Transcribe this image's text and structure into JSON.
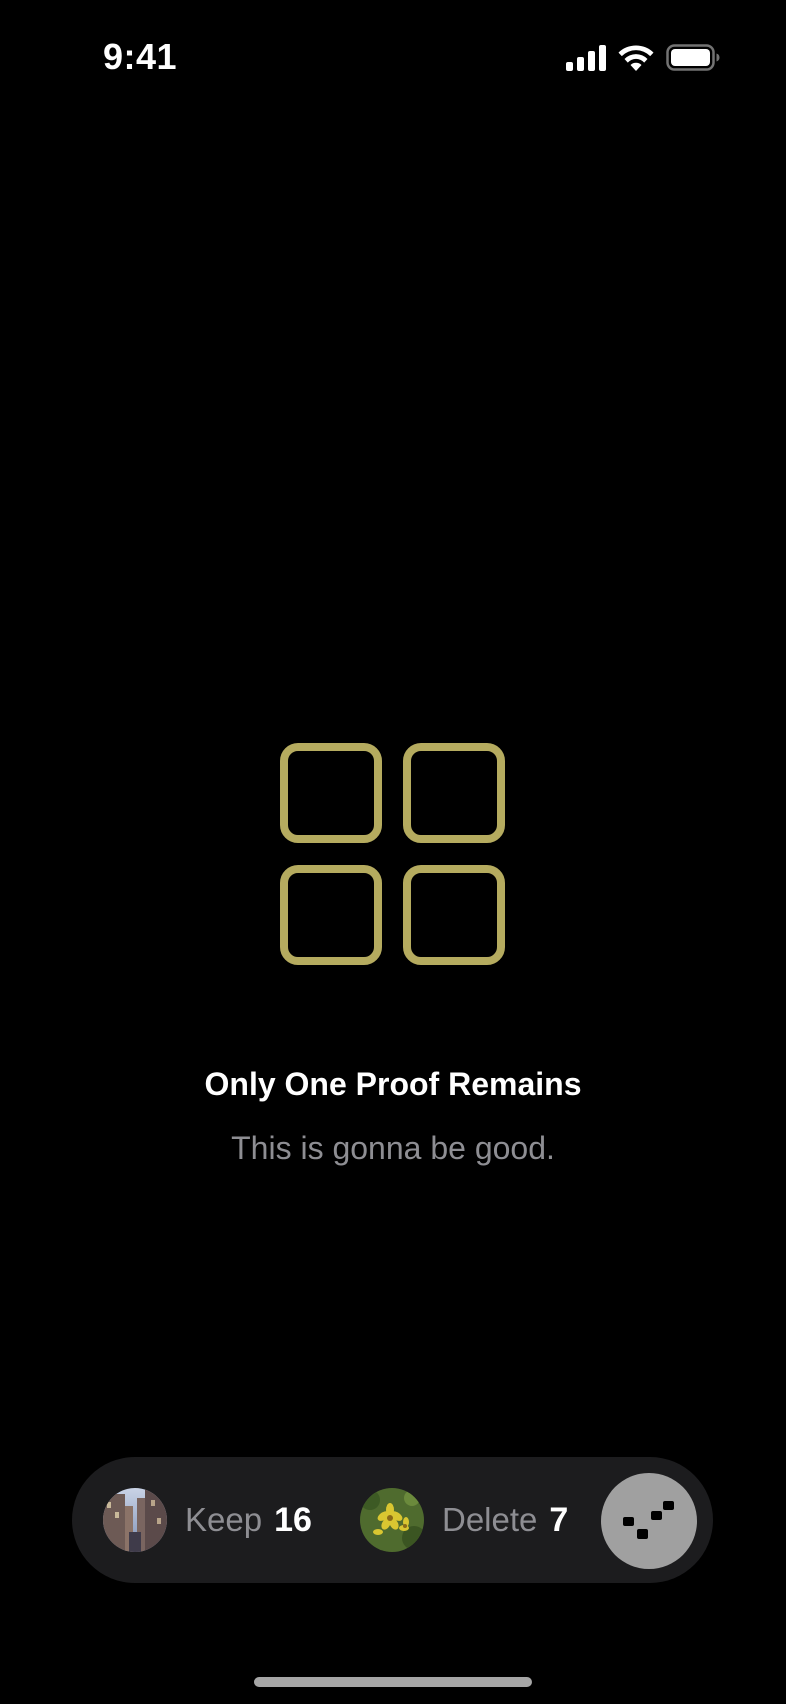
{
  "status_bar": {
    "time": "9:41",
    "icons": [
      "cellular-signal-icon",
      "wifi-icon",
      "battery-icon"
    ]
  },
  "empty_state": {
    "icon": "grid-four-squares-icon",
    "icon_color": "#b5ab5f",
    "title": "Only One Proof Remains",
    "subtitle": "This is gonna be good."
  },
  "bottom_bar": {
    "keep": {
      "label": "Keep",
      "count": "16",
      "thumbnail": "city-alley-photo"
    },
    "delete": {
      "label": "Delete",
      "count": "7",
      "thumbnail": "yellow-flowers-photo"
    },
    "action_button": {
      "icon": "dots-pattern-icon",
      "color": "#a0a0a0"
    }
  },
  "colors": {
    "background": "#000000",
    "pill_background": "#1c1c1e",
    "secondary_text": "#8e8e93",
    "accent": "#b5ab5f"
  }
}
